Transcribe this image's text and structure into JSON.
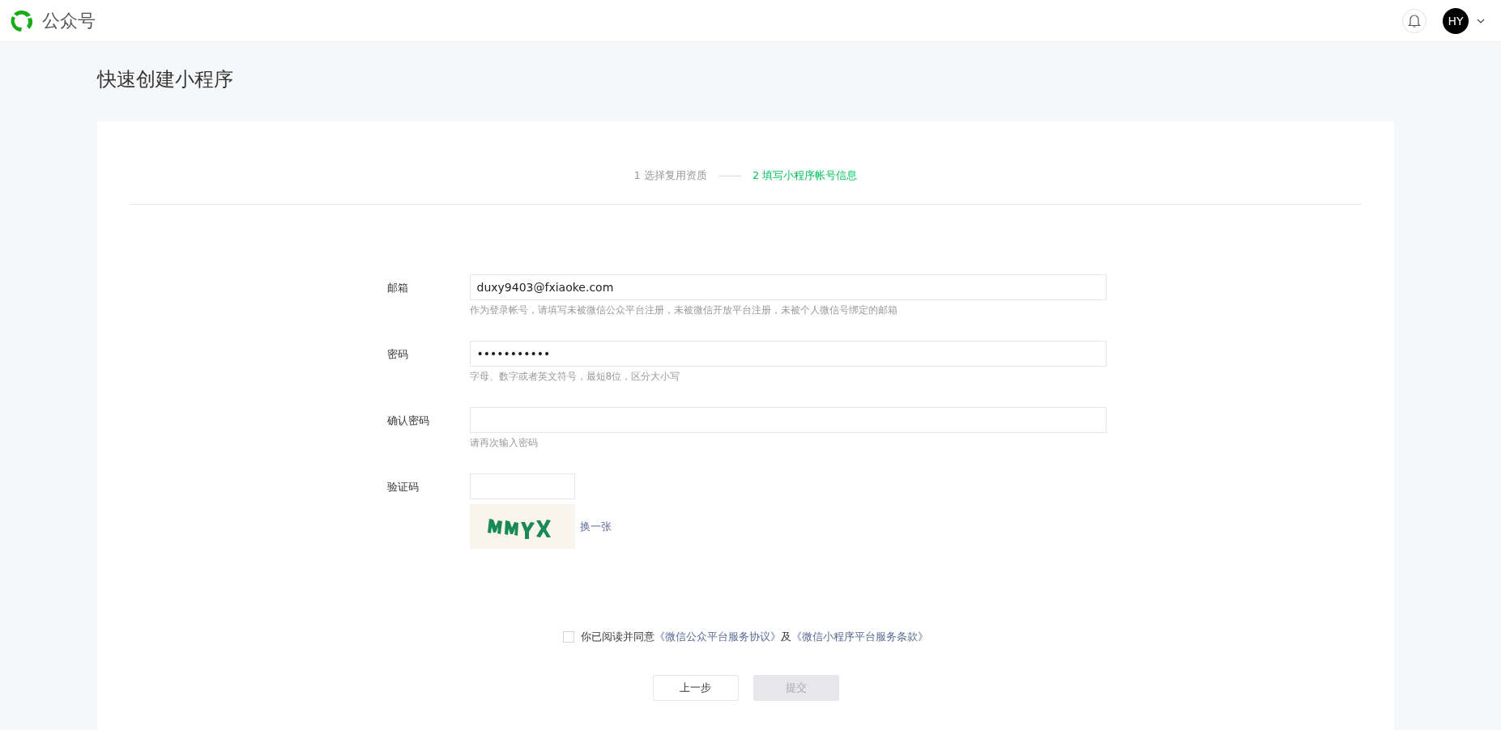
{
  "header": {
    "brand": "公众号",
    "avatar": "HY"
  },
  "page_title": "快速创建小程序",
  "steps": [
    {
      "label": "1 选择复用资质",
      "selected": false
    },
    {
      "label": "2 填写小程序帐号信息",
      "selected": true
    }
  ],
  "fields": [
    {
      "kind": "text",
      "label": "邮箱",
      "value": "duxy9403@fxiaoke.com",
      "hint": "作为登录帐号，请填写未被微信公众平台注册，未被微信开放平台注册，未被个人微信号绑定的邮箱"
    },
    {
      "kind": "text",
      "label": "密码",
      "value": "•••••••••••",
      "hint": "字母、数字或者英文符号，最短8位，区分大小写"
    },
    {
      "kind": "text",
      "label": "确认密码",
      "hint": "请再次输入密码"
    },
    {
      "kind": "captcha",
      "label": "验证码",
      "refresh": "换一张"
    }
  ],
  "agreement": {
    "checked": false,
    "parts": [
      {
        "kind": "text",
        "text": "你已阅读并同意"
      },
      {
        "kind": "link",
        "text": "《微信公众平台服务协议》"
      },
      {
        "kind": "text",
        "text": "及"
      },
      {
        "kind": "link",
        "text": "《微信小程序平台服务条款》"
      }
    ]
  },
  "buttons": [
    {
      "label": "上一步",
      "disabled": false
    },
    {
      "label": "提交",
      "disabled": true
    }
  ]
}
